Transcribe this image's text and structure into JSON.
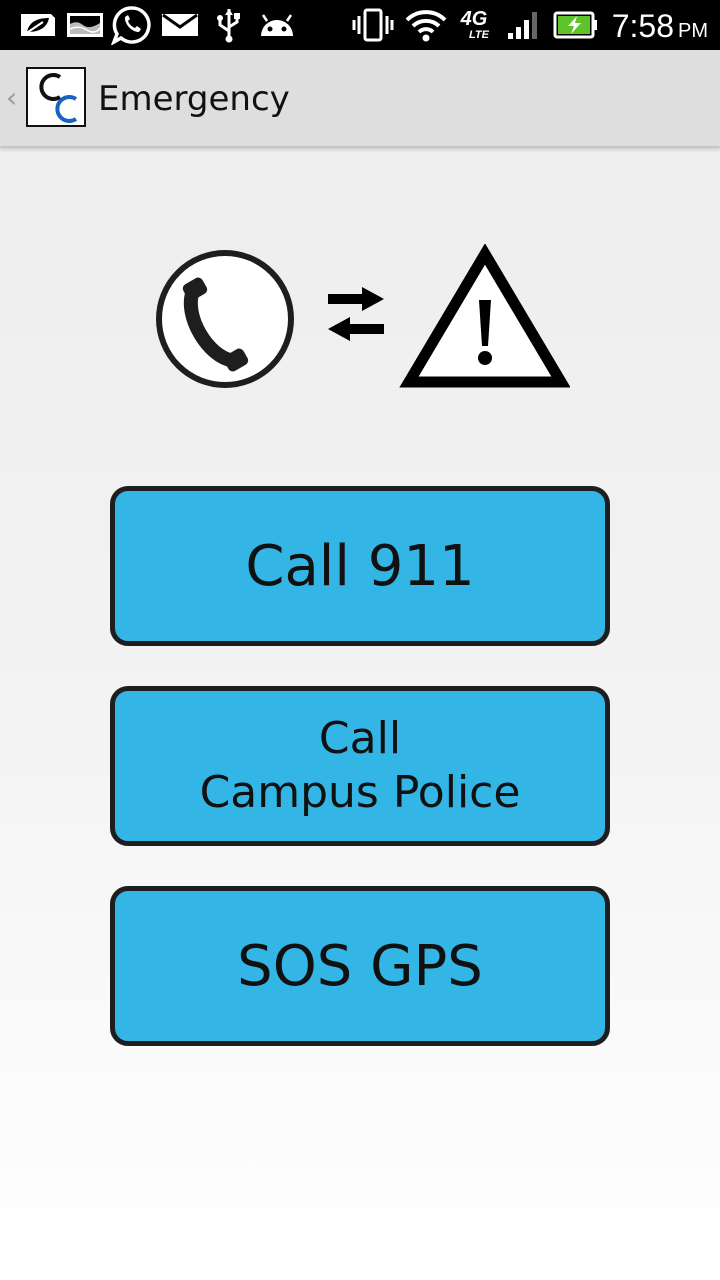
{
  "status_bar": {
    "time": "7:58",
    "ampm": "PM",
    "network_type": "4G",
    "network_subtype": "LTE",
    "battery_state": "charging",
    "icons": [
      "leaf-notification-icon",
      "gallery-icon",
      "whatsapp-icon",
      "email-icon",
      "usb-icon",
      "android-debug-icon",
      "vibrate-icon",
      "wifi-icon",
      "lte-icon",
      "signal-icon",
      "battery-icon"
    ],
    "colors": {
      "background": "#000000",
      "battery_fill": "#5fc42b"
    }
  },
  "action_bar": {
    "logo_letters": "CC",
    "title": "Emergency"
  },
  "hero": {
    "icons": [
      "phone-icon",
      "exchange-arrows-icon",
      "warning-triangle-icon"
    ]
  },
  "buttons": {
    "call_911": "Call 911",
    "call_police_line1": "Call",
    "call_police_line2": "Campus Police",
    "sos_gps": "SOS GPS"
  },
  "colors": {
    "button_fill": "#33b5e5",
    "button_border": "#1e1e1e",
    "logo_blue": "#1565c0"
  }
}
